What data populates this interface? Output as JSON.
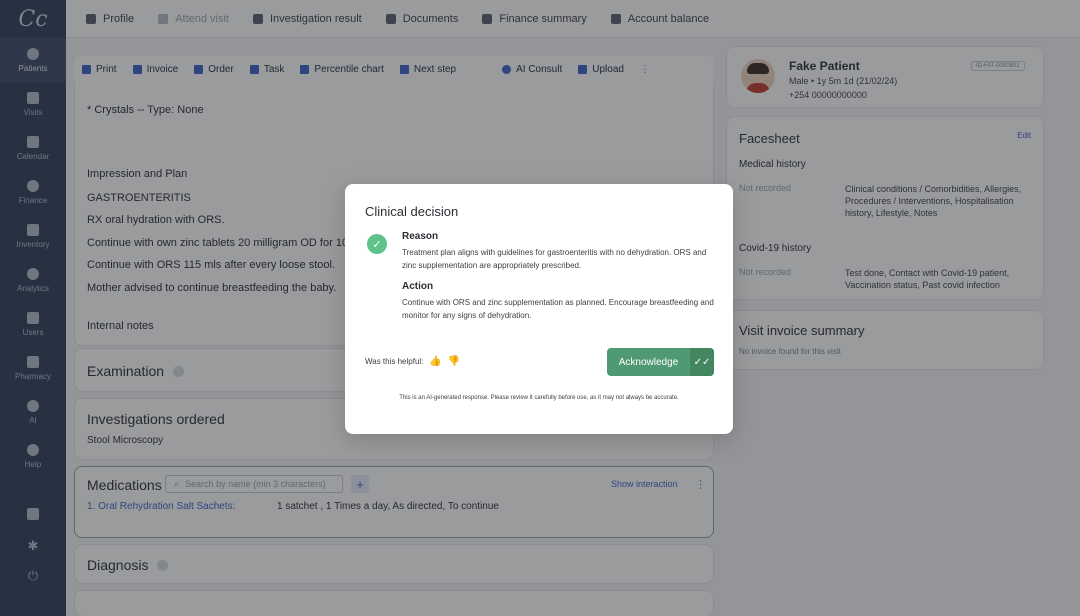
{
  "app": {
    "logo": "Cc"
  },
  "sidebar": {
    "items": [
      {
        "label": "Patients",
        "icon": "patients-icon"
      },
      {
        "label": "Visits",
        "icon": "visits-icon"
      },
      {
        "label": "Calendar",
        "icon": "calendar-icon"
      },
      {
        "label": "Finance",
        "icon": "finance-icon"
      },
      {
        "label": "Inventory",
        "icon": "inventory-icon"
      },
      {
        "label": "Analytics",
        "icon": "analytics-icon"
      },
      {
        "label": "Users",
        "icon": "users-icon"
      },
      {
        "label": "Pharmacy",
        "icon": "pharmacy-icon"
      },
      {
        "label": "AI",
        "icon": "ai-icon"
      },
      {
        "label": "Help",
        "icon": "help-icon"
      }
    ],
    "bottom": {
      "settings_glyph": "✱",
      "power_glyph": "⏻"
    }
  },
  "topnav": [
    {
      "label": "Profile",
      "dim": false
    },
    {
      "label": "Attend visit",
      "dim": true
    },
    {
      "label": "Investigation result",
      "dim": false
    },
    {
      "label": "Documents",
      "dim": false
    },
    {
      "label": "Finance summary",
      "dim": false
    },
    {
      "label": "Account balance",
      "dim": false
    }
  ],
  "toolbar": {
    "print": "Print",
    "invoice": "Invoice",
    "order": "Order",
    "task": "Task",
    "percentile": "Percentile chart",
    "next_step": "Next step",
    "ai_consult": "AI Consult",
    "upload": "Upload"
  },
  "note": {
    "crystals": "* Crystals -- Type: None",
    "impression": "Impression and Plan",
    "diagnosis": "GASTROENTERITIS",
    "rx": "RX oral hydration with ORS.",
    "zinc": "Continue with own zinc tablets 20 milligram OD for 10",
    "ors": "Continue with ORS 115 mls after every loose stool.",
    "mother": "Mother advised to continue breastfeeding the baby.",
    "internal_notes": "Internal notes"
  },
  "sections": {
    "examination": "Examination",
    "investigations": "Investigations ordered",
    "investigation_item": "Stool Microscopy",
    "medications": "Medications",
    "med_search_placeholder": "Search by name (min 3 characters)",
    "show_interaction": "Show interaction",
    "med_name": "1. Oral Rehydration Salt Sachets:",
    "med_dose": "1 satchet , 1 Times a day, As directed, To continue",
    "diagnosis": "Diagnosis"
  },
  "patient": {
    "name": "Fake Patient",
    "id": "ID-FAT-0000801",
    "meta": "Male  •  1y 5m 1d (21/02/24)",
    "phone": "+254 00000000000"
  },
  "facesheet": {
    "title": "Facesheet",
    "edit": "Edit",
    "medical_history": "Medical history",
    "mh_status": "Not recorded",
    "mh_desc": "Clinical conditions / Comorbidities, Allergies, Procedures / Interventions, Hospitalisation history, Lifestyle, Notes",
    "covid_history": "Covid-19 history",
    "covid_status": "Not recorded",
    "covid_desc": "Test done, Contact with Covid-19 patient, Vaccination status, Past covid infection"
  },
  "invoice": {
    "title": "Visit invoice summary",
    "note": "No invoice found for this visit"
  },
  "modal": {
    "title": "Clinical decision",
    "reason_heading": "Reason",
    "reason_text": "Treatment plan aligns with guidelines for gastroenteritis with no dehydration. ORS and zinc supplementation are appropriately prescribed.",
    "action_heading": "Action",
    "action_text": "Continue with ORS and zinc supplementation as planned. Encourage breastfeeding and monitor for any signs of dehydration.",
    "helpful_label": "Was this helpful:",
    "acknowledge": "Acknowledge",
    "disclaimer": "This is an AI-generated response. Please review it carefully before use, as it may not always be accurate."
  },
  "colors": {
    "sidebar": "#2f3e5a",
    "accent": "#3b63c9",
    "success": "#5ec28a",
    "acknowledge": "#4f9a73"
  }
}
